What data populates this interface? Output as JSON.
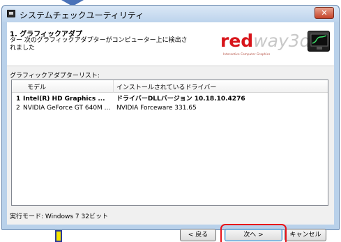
{
  "window": {
    "title": "システムチェックユーティリティ",
    "close_label": "✕"
  },
  "header": {
    "step_title": "1. グラフィックアダプ",
    "step_description": "ター 次のグラフィックアダプターがコンピューター上に検出されました",
    "logo_word_1": "red",
    "logo_word_2": "way3d",
    "logo_tagline": "Interactive Computer Graphics"
  },
  "adapter_list": {
    "label": "グラフィックアダプターリスト:",
    "columns": [
      "モデル",
      "インストールされているドライバー"
    ],
    "rows": [
      {
        "index": "1",
        "model": "Intel(R) HD Graphics ...",
        "driver": "ドライバーDLLバージョン 10.18.10.4276",
        "bold": true
      },
      {
        "index": "2",
        "model": "NVIDIA GeForce GT 640M ...",
        "driver": "NVIDIA Forceware 331.65",
        "bold": false
      }
    ]
  },
  "status": {
    "run_mode": "実行モード: Windows 7 32ビット"
  },
  "buttons": {
    "back": "< 戻る",
    "next": "次へ >",
    "cancel": "キャンセル"
  },
  "colors": {
    "accent_highlight": "#e8141a",
    "logo_red": "#d8141a",
    "window_frame": "#b9d1ea"
  }
}
